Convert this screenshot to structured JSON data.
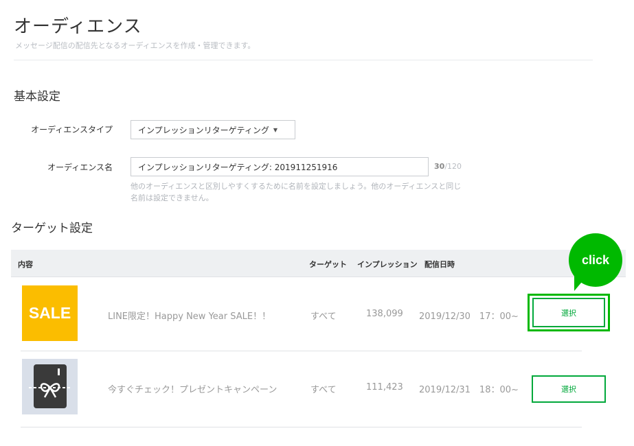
{
  "header": {
    "title": "オーディエンス",
    "subtitle": "メッセージ配信の配信先となるオーディエンスを作成・管理できます。"
  },
  "basic_settings": {
    "section_title": "基本設定",
    "type_label": "オーディエンスタイプ",
    "type_value": "インプレッションリターゲティング",
    "name_label": "オーディエンス名",
    "name_value": "インプレッションリターゲティング: 201911251916",
    "char_count_current": "30",
    "char_count_max": "/120",
    "help_text": "他のオーディエンスと区別しやすくするために名前を設定しましょう。他のオーディエンスと同じ名前は設定できません。"
  },
  "target_settings": {
    "section_title": "ターゲット設定",
    "columns": {
      "content": "内容",
      "target": "ターゲット",
      "impressions": "インプレッション",
      "date": "配信日時"
    },
    "rows": [
      {
        "thumb_text": "SALE",
        "title": "LINE限定！Happy New Year SALE！！",
        "target": "すべて",
        "impressions": "138,099",
        "date": "2019/12/30　17：00~",
        "button": "選択"
      },
      {
        "thumb_icon": "gift-icon",
        "title": "今すぐチェック！プレゼントキャンペーン",
        "target": "すべて",
        "impressions": "111,423",
        "date": "2019/12/31　18：00~",
        "button": "選択"
      }
    ]
  },
  "annotation": {
    "bubble_text": "click",
    "color": "#00b900"
  },
  "colors": {
    "accent_green": "#00a83a",
    "sale_yellow": "#fbbd00"
  }
}
